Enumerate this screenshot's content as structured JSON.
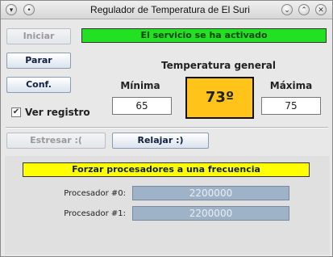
{
  "window": {
    "title": "Regulador de Temperatura de El Suri",
    "controls": {
      "menu_icon": "window-menu-icon",
      "close": "✕",
      "minimize": "⌄",
      "maximize": "⌃"
    }
  },
  "buttons": {
    "iniciar": "Iniciar",
    "parar": "Parar",
    "conf": "Conf.",
    "estresar": "Estresar :(",
    "relajar": "Relajar :)"
  },
  "status": {
    "text": "El servicio se ha activado",
    "color": "#22e022"
  },
  "temperature": {
    "heading": "Temperatura general",
    "min_label": "Mínima",
    "max_label": "Máxima",
    "min_value": "65",
    "max_value": "75",
    "current": "73º",
    "current_color": "#ffc31a"
  },
  "checkbox": {
    "label": "Ver registro",
    "checked": true
  },
  "processors": {
    "banner": "Forzar procesadores a una frecuencia",
    "banner_color": "#ffff00",
    "items": [
      {
        "label": "Procesador #0:",
        "value": "2200000"
      },
      {
        "label": "Procesador #1:",
        "value": "2200000"
      }
    ]
  }
}
